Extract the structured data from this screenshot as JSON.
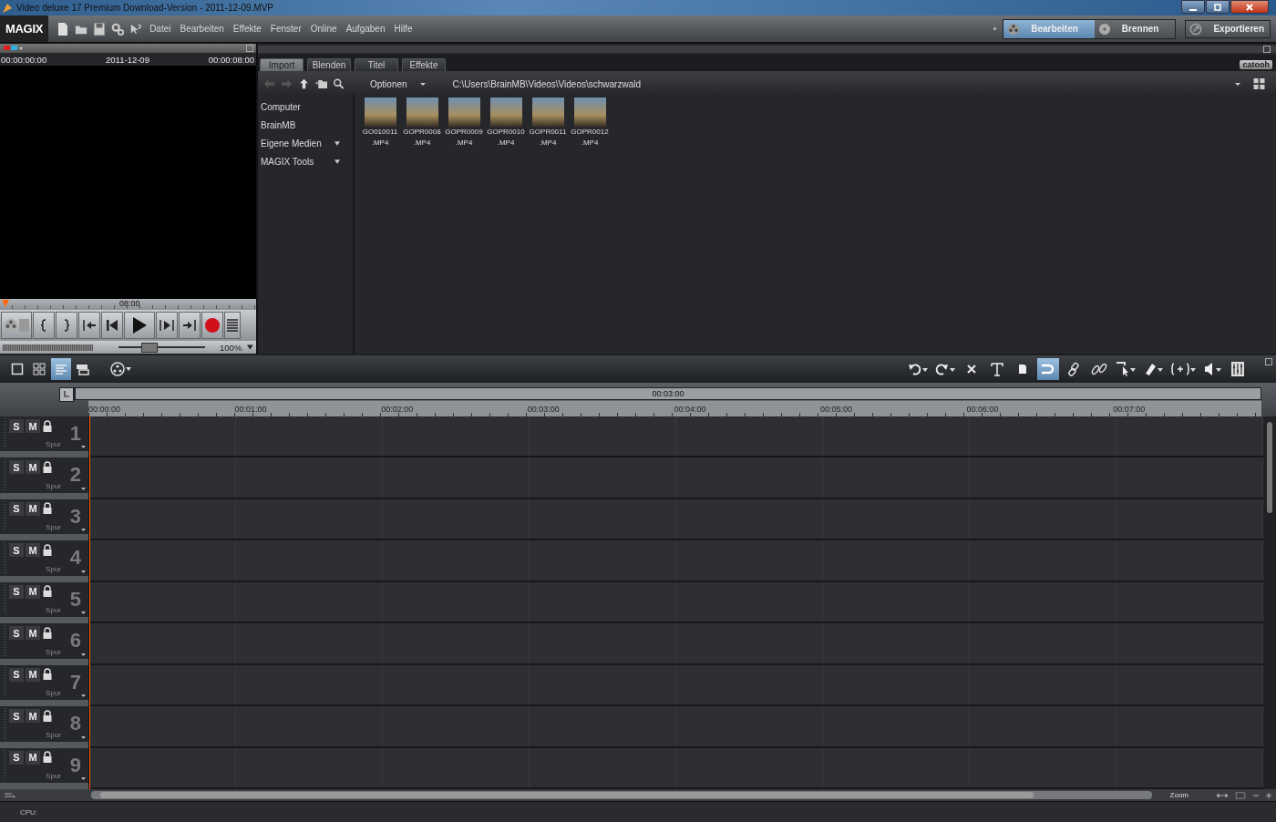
{
  "window": {
    "title": "Video deluxe 17 Premium Download-Version - 2011-12-09.MVP"
  },
  "logo": "MAGIX",
  "menu": [
    "Datei",
    "Bearbeiten",
    "Effekte",
    "Fenster",
    "Online",
    "Aufgaben",
    "Hilfe"
  ],
  "modes": [
    {
      "label": "Bearbeiten",
      "selected": true
    },
    {
      "label": "Brennen",
      "selected": false
    }
  ],
  "export_button": "Exportieren",
  "preview": {
    "time_start": "00:00:00:00",
    "date": "2011-12-09",
    "time_end": "00:00:08:00",
    "ruler_label": "08:00",
    "zoom": "100%",
    "level": 0.36
  },
  "browser": {
    "tabs": [
      {
        "label": "Import",
        "selected": true
      },
      {
        "label": "Blenden",
        "selected": false
      },
      {
        "label": "Titel",
        "selected": false
      },
      {
        "label": "Effekte",
        "selected": false
      }
    ],
    "brand": "catooh",
    "options": "Optionen",
    "path": "C:\\Users\\BrainMB\\Videos\\Videos\\schwarzwald",
    "places": [
      {
        "label": "Computer",
        "expandable": false
      },
      {
        "label": "BrainMB",
        "expandable": false
      },
      {
        "label": "Eigene Medien",
        "expandable": true
      },
      {
        "label": "MAGIX Tools",
        "expandable": true
      }
    ],
    "files": [
      {
        "name": "GO010011",
        "ext": ".MP4"
      },
      {
        "name": "GOPR0008",
        "ext": ".MP4"
      },
      {
        "name": "GOPR0009",
        "ext": ".MP4"
      },
      {
        "name": "GOPR0010",
        "ext": ".MP4"
      },
      {
        "name": "GOPR0011",
        "ext": ".MP4"
      },
      {
        "name": "GOPR0012",
        "ext": ".MP4"
      }
    ]
  },
  "timeline": {
    "views": [
      {
        "kind": "single",
        "selected": false
      },
      {
        "kind": "storyboard",
        "selected": false
      },
      {
        "kind": "timeline",
        "selected": true
      },
      {
        "kind": "scene",
        "selected": false
      }
    ],
    "tools": [
      {
        "kind": "undo",
        "selected": false
      },
      {
        "kind": "redo",
        "selected": false
      },
      {
        "kind": "delete",
        "selected": false
      },
      {
        "kind": "text",
        "selected": false
      },
      {
        "kind": "marker",
        "selected": false
      },
      {
        "kind": "snap",
        "selected": true
      },
      {
        "kind": "link",
        "selected": false
      },
      {
        "kind": "unlink",
        "selected": false
      },
      {
        "kind": "pointer",
        "selected": false
      },
      {
        "kind": "eraser",
        "selected": false
      },
      {
        "kind": "bracket",
        "selected": false
      },
      {
        "kind": "speaker",
        "selected": false
      },
      {
        "kind": "mixer",
        "selected": false
      }
    ],
    "overview_time": "00:03:00",
    "ruler": [
      "00:00:00",
      "00:01:00",
      "00:02:00",
      "00:03:00",
      "00:04:00",
      "00:05:00",
      "00:06:00",
      "00:07:00"
    ],
    "tracks": [
      {
        "number": "1",
        "solo": "S",
        "mute": "M",
        "name": "Spur"
      },
      {
        "number": "2",
        "solo": "S",
        "mute": "M",
        "name": "Spur"
      },
      {
        "number": "3",
        "solo": "S",
        "mute": "M",
        "name": "Spur"
      },
      {
        "number": "4",
        "solo": "S",
        "mute": "M",
        "name": "Spur"
      },
      {
        "number": "5",
        "solo": "S",
        "mute": "M",
        "name": "Spur"
      },
      {
        "number": "6",
        "solo": "S",
        "mute": "M",
        "name": "Spur"
      },
      {
        "number": "7",
        "solo": "S",
        "mute": "M",
        "name": "Spur"
      },
      {
        "number": "8",
        "solo": "S",
        "mute": "M",
        "name": "Spur"
      },
      {
        "number": "9",
        "solo": "S",
        "mute": "M",
        "name": "Spur"
      }
    ],
    "zoom": "Zoom"
  },
  "status": "CPU:"
}
